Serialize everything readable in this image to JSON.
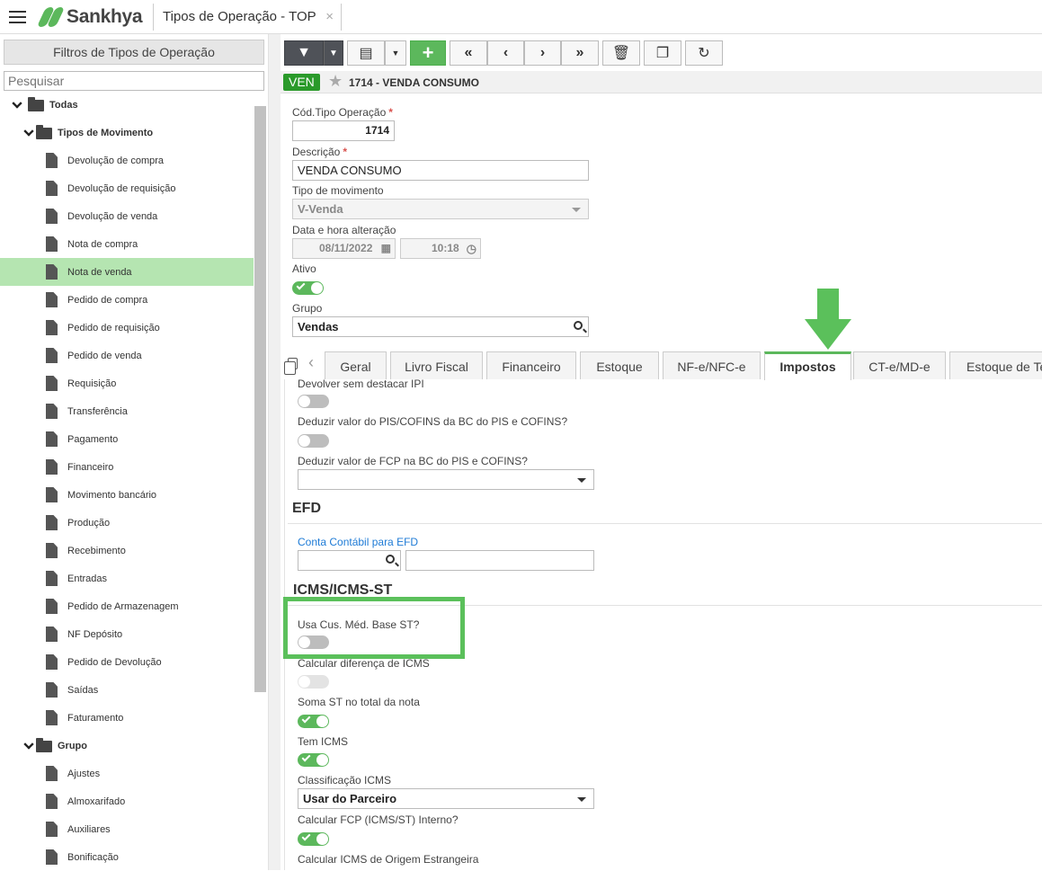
{
  "app": {
    "brand": "Sankhya",
    "tab_title": "Tipos de Operação - TOP",
    "tab_close": "×"
  },
  "sidebar": {
    "header": "Filtros de Tipos de Operação",
    "search_placeholder": "Pesquisar",
    "root": "Todas",
    "group1": "Tipos de Movimento",
    "group1_items": [
      "Devolução de compra",
      "Devolução de requisição",
      "Devolução de venda",
      "Nota de compra",
      "Nota de venda",
      "Pedido de compra",
      "Pedido de requisição",
      "Pedido de venda",
      "Requisição",
      "Transferência",
      "Pagamento",
      "Financeiro",
      "Movimento bancário",
      "Produção",
      "Recebimento",
      "Entradas",
      "Pedido de Armazenagem",
      "NF Depósito",
      "Pedido de Devolução",
      "Saídas",
      "Faturamento"
    ],
    "selected_item": "Nota de venda",
    "group2": "Grupo",
    "group2_items": [
      "Ajustes",
      "Almoxarifado",
      "Auxiliares",
      "Bonificação"
    ]
  },
  "record": {
    "badge": "VEN",
    "title": "1714 - VENDA CONSUMO"
  },
  "form": {
    "cod_label": "Cód.Tipo Operação",
    "cod_value": "1714",
    "desc_label": "Descrição",
    "desc_value": "VENDA CONSUMO",
    "tipo_label": "Tipo de movimento",
    "tipo_value": "V-Venda",
    "data_label": "Data e hora alteração",
    "date_value": "08/11/2022",
    "time_value": "10:18",
    "ativo_label": "Ativo",
    "ativo_on": true,
    "grupo_label": "Grupo",
    "grupo_value": "Vendas",
    "required_mark": "*"
  },
  "tabs": [
    "Geral",
    "Livro Fiscal",
    "Financeiro",
    "Estoque",
    "NF-e/NFC-e",
    "Impostos",
    "CT-e/MD-e",
    "Estoque de Te"
  ],
  "active_tab": "Impostos",
  "impostos": {
    "devolver_label": "Devolver sem destacar IPI",
    "deduzir_pis_label": "Deduzir valor do PIS/COFINS da BC do PIS e COFINS?",
    "deduzir_fcp_label": "Deduzir valor de FCP na BC do PIS e COFINS?",
    "efd_title": "EFD",
    "conta_label": "Conta Contábil para EFD",
    "icms_title": "ICMS/ICMS-ST",
    "usa_cus_label": "Usa Cus. Méd. Base ST?",
    "calc_dif_label": "Calcular diferença de ICMS",
    "soma_st_label": "Soma ST no total da nota",
    "tem_icms_label": "Tem ICMS",
    "class_label": "Classificação ICMS",
    "class_value": "Usar do Parceiro",
    "fcp_label": "Calcular FCP (ICMS/ST) Interno?",
    "origem_label": "Calcular ICMS de Origem Estrangeira"
  },
  "colors": {
    "accent": "#5cb85c",
    "badge": "#2a9a2a",
    "selected": "#b5e5b1",
    "link": "#1e7bd6"
  }
}
